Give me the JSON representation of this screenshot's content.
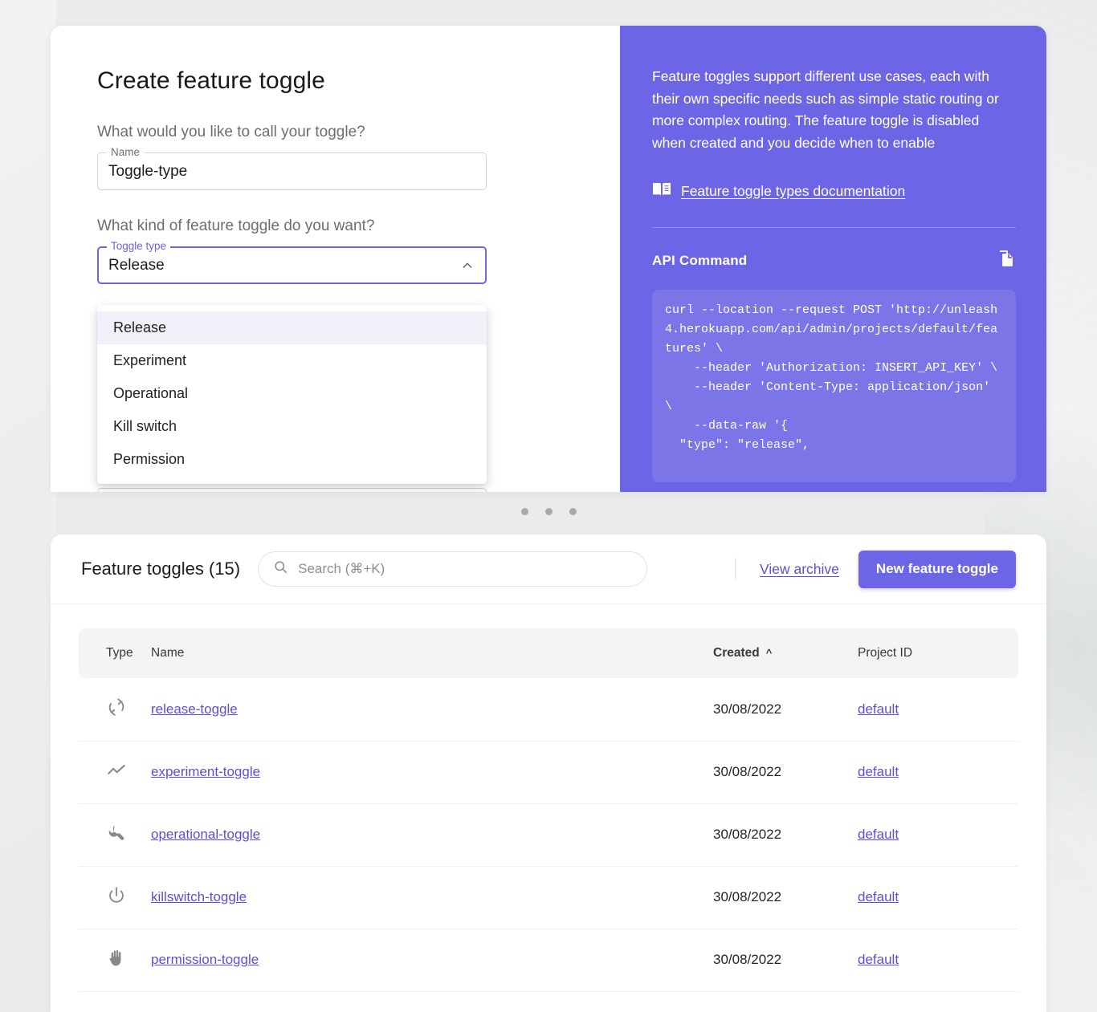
{
  "theme": {
    "accent": "#6C65E5",
    "link": "#5A50D6",
    "panel_bg": "#6C65E5",
    "page_bg": "#EBEBEC"
  },
  "create_panel": {
    "title": "Create feature toggle",
    "name_question": "What would you like to call your toggle?",
    "name_label": "Name",
    "name_value": "Toggle-type",
    "type_question": "What kind of feature toggle do you want?",
    "type_label": "Toggle type",
    "type_value": "Release",
    "chevron_icon": "chevron-up-icon",
    "options": [
      {
        "label": "Release",
        "selected": true
      },
      {
        "label": "Experiment",
        "selected": false
      },
      {
        "label": "Operational",
        "selected": false
      },
      {
        "label": "Kill switch",
        "selected": false
      },
      {
        "label": "Permission",
        "selected": false
      }
    ]
  },
  "info_panel": {
    "description": "Feature toggles support different use cases, each with their own specific needs such as simple static routing or more complex routing. The feature toggle is disabled when created and you decide when to enable",
    "doc_icon": "book-icon",
    "doc_link": "Feature toggle types documentation",
    "api_title": "API Command",
    "copy_icon": "copy-icon",
    "api_code": "curl --location --request POST 'http://unleash4.herokuapp.com/api/admin/projects/default/features' \\\n    --header 'Authorization: INSERT_API_KEY' \\\n    --header 'Content-Type: application/json' \\\n    --data-raw '{\n  \"type\": \"release\","
  },
  "carousel": {
    "dots": 3,
    "active_index": 0
  },
  "list_panel": {
    "title": "Feature toggles (15)",
    "search_icon": "search-icon",
    "search_value": "",
    "search_placeholder": "Search (⌘+K)",
    "view_archive_label": "View archive",
    "new_toggle_label": "New feature toggle",
    "columns": [
      {
        "key": "type",
        "label": "Type",
        "sorted": false
      },
      {
        "key": "name",
        "label": "Name",
        "sorted": false
      },
      {
        "key": "created",
        "label": "Created",
        "sorted": true,
        "sort_icon": "chevron-up-icon"
      },
      {
        "key": "project",
        "label": "Project ID",
        "sorted": false
      }
    ],
    "rows": [
      {
        "icon": "loop-icon",
        "name": "release-toggle",
        "created": "30/08/2022",
        "project": "default"
      },
      {
        "icon": "trending-up-icon",
        "name": "experiment-toggle",
        "created": "30/08/2022",
        "project": "default"
      },
      {
        "icon": "wrench-icon",
        "name": "operational-toggle",
        "created": "30/08/2022",
        "project": "default"
      },
      {
        "icon": "power-icon",
        "name": "killswitch-toggle",
        "created": "30/08/2022",
        "project": "default"
      },
      {
        "icon": "hand-icon",
        "name": "permission-toggle",
        "created": "30/08/2022",
        "project": "default"
      }
    ]
  }
}
